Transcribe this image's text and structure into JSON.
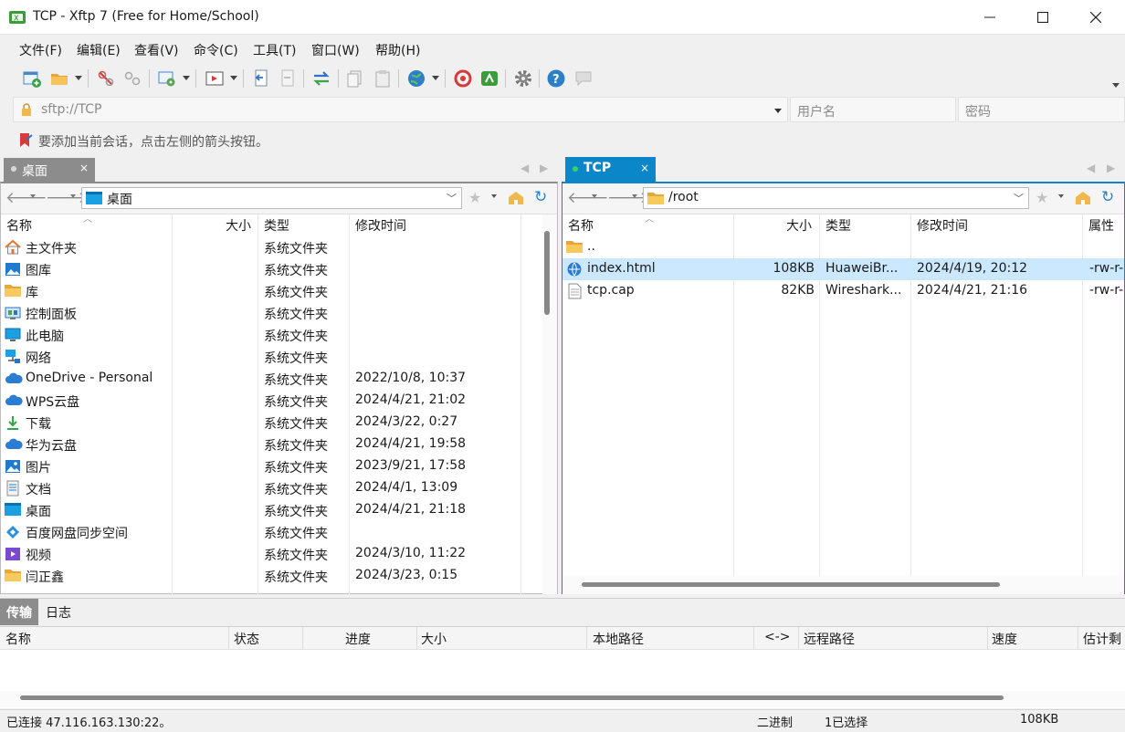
{
  "window": {
    "title": "TCP - Xftp 7 (Free for Home/School)"
  },
  "menu": {
    "items": [
      "文件(F)",
      "编辑(E)",
      "查看(V)",
      "命令(C)",
      "工具(T)",
      "窗口(W)",
      "帮助(H)"
    ]
  },
  "address": {
    "url": "sftp://TCP",
    "username_placeholder": "用户名",
    "password_placeholder": "密码"
  },
  "hint": "要添加当前会话，点击左侧的箭头按钮。",
  "left": {
    "tab": "桌面",
    "path": "桌面",
    "columns": {
      "name": "名称",
      "size": "大小",
      "type": "类型",
      "modified": "修改时间"
    },
    "rows": [
      {
        "name": "主文件夹",
        "size": "",
        "type": "系统文件夹",
        "modified": "",
        "icon": "home-icon"
      },
      {
        "name": "图库",
        "size": "",
        "type": "系统文件夹",
        "modified": "",
        "icon": "gallery-icon"
      },
      {
        "name": "库",
        "size": "",
        "type": "系统文件夹",
        "modified": "",
        "icon": "folder-icon"
      },
      {
        "name": "控制面板",
        "size": "",
        "type": "系统文件夹",
        "modified": "",
        "icon": "control-panel-icon"
      },
      {
        "name": "此电脑",
        "size": "",
        "type": "系统文件夹",
        "modified": "",
        "icon": "computer-icon"
      },
      {
        "name": "网络",
        "size": "",
        "type": "系统文件夹",
        "modified": "",
        "icon": "network-icon"
      },
      {
        "name": "OneDrive - Personal",
        "size": "",
        "type": "系统文件夹",
        "modified": "2022/10/8, 10:37",
        "icon": "cloud-icon"
      },
      {
        "name": "WPS云盘",
        "size": "",
        "type": "系统文件夹",
        "modified": "2024/4/21, 21:02",
        "icon": "cloud-icon"
      },
      {
        "name": "下载",
        "size": "",
        "type": "系统文件夹",
        "modified": "2024/3/22, 0:27",
        "icon": "download-icon"
      },
      {
        "name": "华为云盘",
        "size": "",
        "type": "系统文件夹",
        "modified": "2024/4/21, 19:58",
        "icon": "cloud-icon"
      },
      {
        "name": "图片",
        "size": "",
        "type": "系统文件夹",
        "modified": "2023/9/21, 17:58",
        "icon": "picture-icon"
      },
      {
        "name": "文档",
        "size": "",
        "type": "系统文件夹",
        "modified": "2024/4/1, 13:09",
        "icon": "document-icon"
      },
      {
        "name": "桌面",
        "size": "",
        "type": "系统文件夹",
        "modified": "2024/4/21, 21:18",
        "icon": "desktop-icon"
      },
      {
        "name": "百度网盘同步空间",
        "size": "",
        "type": "系统文件夹",
        "modified": "",
        "icon": "sync-icon"
      },
      {
        "name": "视频",
        "size": "",
        "type": "系统文件夹",
        "modified": "2024/3/10, 11:22",
        "icon": "video-icon"
      },
      {
        "name": "闫正鑫",
        "size": "",
        "type": "系统文件夹",
        "modified": "2024/3/23, 0:15",
        "icon": "folder-icon"
      }
    ]
  },
  "right": {
    "tab": "TCP",
    "path": "/root",
    "columns": {
      "name": "名称",
      "size": "大小",
      "type": "类型",
      "modified": "修改时间",
      "attrs": "属性"
    },
    "rows": [
      {
        "name": "..",
        "size": "",
        "type": "",
        "modified": "",
        "attrs": "",
        "icon": "folder-icon"
      },
      {
        "name": "index.html",
        "size": "108KB",
        "type": "HuaweiBr...",
        "modified": "2024/4/19, 20:12",
        "attrs": "-rw-r-",
        "icon": "html-file-icon"
      },
      {
        "name": "tcp.cap",
        "size": "82KB",
        "type": "Wireshark...",
        "modified": "2024/4/21, 21:16",
        "attrs": "-rw-r-",
        "icon": "file-icon"
      }
    ]
  },
  "transfer": {
    "tabs": [
      "传输",
      "日志"
    ],
    "columns": [
      "名称",
      "状态",
      "进度",
      "大小",
      "本地路径",
      "<->",
      "远程路径",
      "速度",
      "估计剩"
    ]
  },
  "status": {
    "connection": "已连接 47.116.163.130:22。",
    "mode": "二进制",
    "selection": "1已选择",
    "size": "108KB"
  },
  "colors": {
    "accent": "#0b86c8",
    "selected_row": "#cce8ff"
  }
}
